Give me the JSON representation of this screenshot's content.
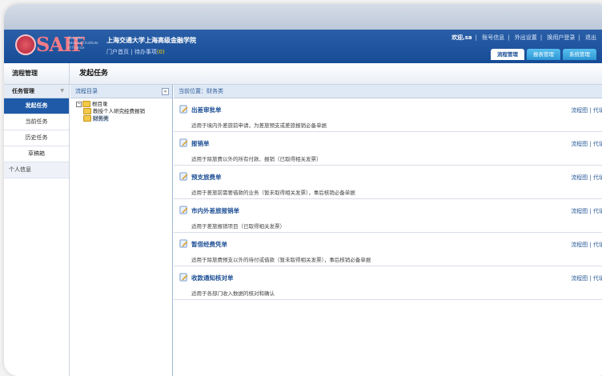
{
  "header": {
    "logo_text": "SAIF",
    "logo_sub": "Shanghai Advanced Institute of Finance",
    "school_name": "上海交通大学上海高级金融学院",
    "home_link": "门户首页",
    "todo_link": "待办事项",
    "todo_count": "(0)",
    "welcome": "欢迎,sa",
    "account_info": "账号信息",
    "away_settings": "外出设置",
    "switch_user": "换用户登录",
    "logout": "退出",
    "tabs": [
      "流程管理",
      "报表管理",
      "系统管理"
    ]
  },
  "section": {
    "left_title": "流程管理",
    "page_title": "发起任务"
  },
  "sidebar": {
    "group_title": "任务管理",
    "items": [
      "发起任务",
      "当前任务",
      "历史任务",
      "草稿箱"
    ],
    "info": "个人信息"
  },
  "tree": {
    "header": "流程目录",
    "root": "根目录",
    "children": [
      "教授个人研究经费报销",
      "财务类"
    ]
  },
  "main": {
    "breadcrumb": "当前位置：财务类",
    "link_label": "流程图 | 代填",
    "entries": [
      {
        "name": "出差审批单",
        "desc": "适用于境内外差旅前申请，为差旅预支或差旅报销必备单据"
      },
      {
        "name": "报销单",
        "desc": "适用于除旅费以外的所有付款、报销（已取得相关发票）"
      },
      {
        "name": "预支旅费单",
        "desc": "适用于差旅前需要借款的业务（暂未取得相关发票），事后核销必备单据"
      },
      {
        "name": "市内外差旅报销单",
        "desc": "适用于差旅报销项目（已取得相关发票）"
      },
      {
        "name": "暂借经费凭单",
        "desc": "适用于除旅费预支以外的待付或借款（暂未取得相关发票），事后核销必备单据"
      },
      {
        "name": "收款通知核对单",
        "desc": "适用于各部门收入数据的核对和确认"
      }
    ]
  },
  "colors": {
    "brand_blue": "#174c96",
    "accent_blue": "#2e97d4",
    "logo_red": "#f27b86"
  }
}
